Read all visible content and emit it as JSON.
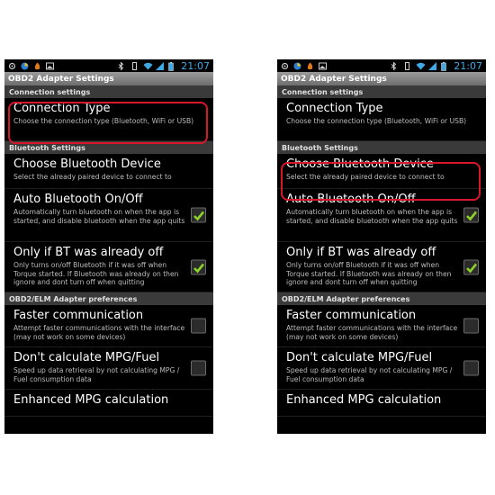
{
  "statusbar": {
    "time": "21:07"
  },
  "app_title": "OBD2 Adapter Settings",
  "sections": {
    "connection": "Connection settings",
    "bluetooth": "Bluetooth Settings",
    "elm": "OBD2/ELM Adapter preferences"
  },
  "items": {
    "connection_type": {
      "title": "Connection Type",
      "summary": "Choose the connection type (Bluetooth, WiFi or USB)"
    },
    "choose_bt": {
      "title": "Choose Bluetooth Device",
      "summary": "Select the already paired device to connect to"
    },
    "auto_bt": {
      "title": "Auto Bluetooth On/Off",
      "summary": "Automatically turn bluetooth on when the app is started, and disable bluetooth when the app quits",
      "checked": true
    },
    "only_bt": {
      "title": "Only if BT was already off",
      "summary": "Only turns on/off Bluetooth if it was off when Torque started. If Bluetooth was already on then ignore and dont turn off when quitting",
      "checked": true
    },
    "faster": {
      "title": "Faster communication",
      "summary": "Attempt faster communications with the interface (may not work on some devices)",
      "checked": false
    },
    "no_mpg": {
      "title": "Don't calculate MPG/Fuel",
      "summary": "Speed up data retrieval by not calculating MPG / Fuel consumption data",
      "checked": false
    },
    "enhanced": {
      "title": "Enhanced MPG calculation"
    }
  },
  "colors": {
    "highlight": "#d8182a",
    "check": "#8bd12a",
    "time": "#3fa9e6"
  }
}
